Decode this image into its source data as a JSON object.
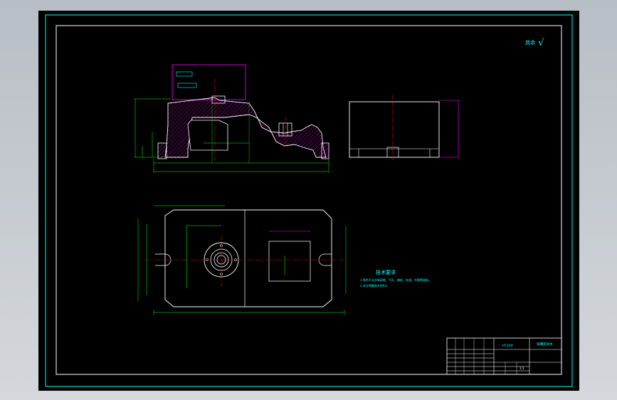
{
  "roughness": {
    "label": "其余",
    "symbol": "√"
  },
  "tech": {
    "title": "技术要求",
    "lines": [
      "1.铸件不允许有砂眼、气孔、缩松、夹渣、冷隔等缺陷。",
      "2.未注明圆角半径R3。"
    ]
  },
  "title_block": {
    "drawing_name": "铣槽夹具体",
    "material": "HT200",
    "scale": "1:1"
  },
  "colors": {
    "frame_outer": "#00ffff",
    "frame_inner": "#ffffff",
    "outline": "#ffffff",
    "dimension": "#00ff00",
    "centerline": "#ff0000",
    "hatch": "#ff00ff"
  }
}
